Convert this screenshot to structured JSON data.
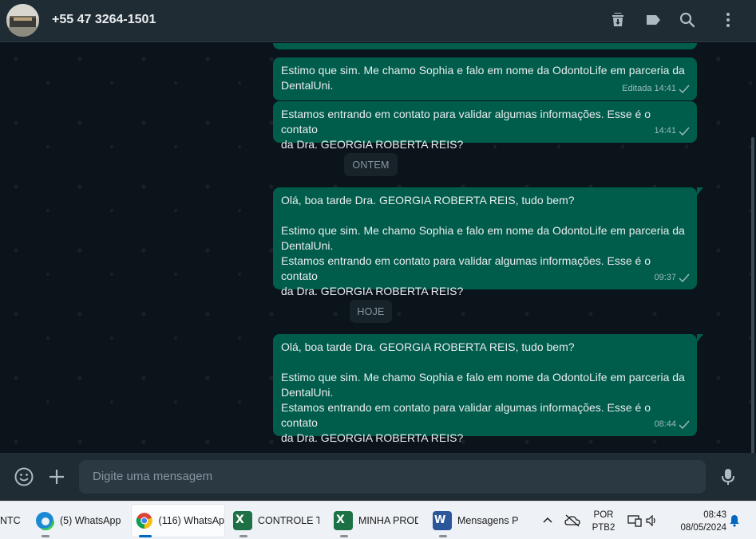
{
  "header": {
    "contact": "+55 47 3264-1501",
    "icons": [
      "archive-icon",
      "label-icon",
      "search-icon",
      "menu-icon"
    ]
  },
  "messages": [
    {
      "lines": [
        "Estimo que sim. Me chamo Sophia e falo em nome da OdontoLife em parceria da",
        "DentalUni."
      ],
      "edited": "Editada",
      "time": "14:41"
    },
    {
      "lines": [
        "Estamos entrando em contato para validar algumas informações. Esse é o contato",
        "da Dra. GEORGIA ROBERTA REIS?"
      ],
      "time": "14:41"
    },
    {
      "date": "ONTEM"
    },
    {
      "lines": [
        "Olá, boa tarde Dra. GEORGIA ROBERTA REIS, tudo bem?",
        "",
        "Estimo que sim. Me chamo Sophia e falo em nome da OdontoLife em parceria da",
        "DentalUni.",
        "Estamos entrando em contato para validar algumas informações. Esse é o contato",
        "da Dra. GEORGIA ROBERTA REIS?"
      ],
      "time": "09:37"
    },
    {
      "date": "HOJE"
    },
    {
      "lines": [
        "Olá, boa tarde Dra. GEORGIA ROBERTA REIS, tudo bem?",
        "",
        "Estimo que sim. Me chamo Sophia e falo em nome da OdontoLife em parceria da",
        "DentalUni.",
        "Estamos entrando em contato para validar algumas informações. Esse é o contato",
        "da Dra. GEORGIA ROBERTA REIS?"
      ],
      "time": "08:44"
    }
  ],
  "composer": {
    "placeholder": "Digite uma mensagem"
  },
  "taskbar": {
    "items": [
      {
        "label": "NTC",
        "icon": "generic"
      },
      {
        "label": "(5) WhatsApp",
        "icon": "edge"
      },
      {
        "label": "(116) WhatsAp",
        "icon": "chrome"
      },
      {
        "label": "CONTROLE TI",
        "icon": "excel"
      },
      {
        "label": "MINHA PROD",
        "icon": "excel"
      },
      {
        "label": "Mensagens Pa",
        "icon": "word"
      }
    ],
    "language": "POR",
    "layout": "PTB2",
    "time": "08:43",
    "date": "08/05/2024"
  }
}
